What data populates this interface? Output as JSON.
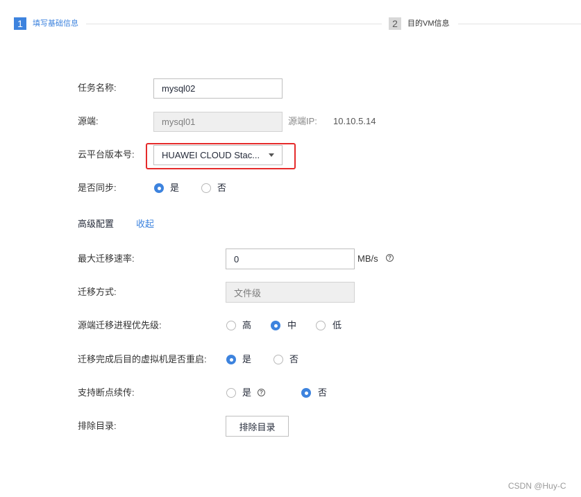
{
  "stepper": {
    "step1": {
      "num": "1",
      "label": "填写基础信息"
    },
    "step2": {
      "num": "2",
      "label": "目的VM信息"
    }
  },
  "form": {
    "task_name": {
      "label": "任务名称:",
      "value": "mysql02"
    },
    "source": {
      "label": "源端:",
      "value": "mysql01",
      "ip_label": "源端IP:",
      "ip_value": "10.10.5.14"
    },
    "cloud_version": {
      "label": "云平台版本号:",
      "selected": "HUAWEI CLOUD Stac..."
    },
    "sync": {
      "label": "是否同步:",
      "options": [
        "是",
        "否"
      ],
      "selected": "是"
    }
  },
  "advanced": {
    "title": "高级配置",
    "collapse_link": "收起",
    "max_rate": {
      "label": "最大迁移速率:",
      "value": "0",
      "unit": "MB/s"
    },
    "migration_mode": {
      "label": "迁移方式:",
      "value": "文件级"
    },
    "priority": {
      "label": "源端迁移进程优先级:",
      "options": [
        "高",
        "中",
        "低"
      ],
      "selected": "中"
    },
    "reboot": {
      "label": "迁移完成后目的虚拟机是否重启:",
      "options": [
        "是",
        "否"
      ],
      "selected": "是"
    },
    "resume": {
      "label": "支持断点续传:",
      "options": [
        "是",
        "否"
      ],
      "selected": "否"
    },
    "exclude": {
      "label": "排除目录:",
      "button": "排除目录"
    }
  },
  "watermark": "CSDN @Huy-C",
  "colors": {
    "accent": "#3d83de",
    "highlight": "#e52a2a"
  }
}
